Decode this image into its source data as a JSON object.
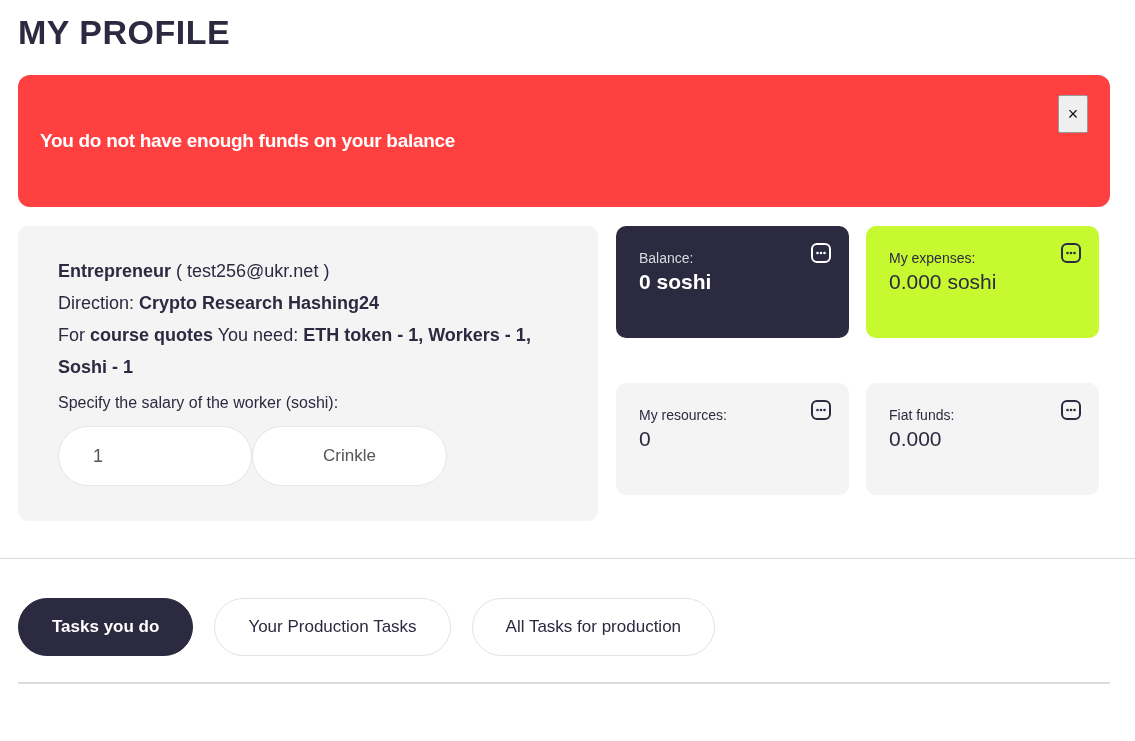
{
  "title": "MY PROFILE",
  "alert": {
    "message": "You do not have enough funds on your balance",
    "close_label": "×"
  },
  "profile": {
    "lines": [
      "**Entrepreneur** ( test256@ukr.net )",
      "Direction: **Crypto Research Hashing24**",
      "For **course quotes** You need: **ETH token - 1, Workers - 1, Soshi - 1**"
    ],
    "salary_label": "Specify the salary of the worker (soshi):",
    "salary_field": {
      "value": "1"
    },
    "submit_button": "Crinkle"
  },
  "stats": [
    {
      "kind": "dark",
      "label": "Balance:",
      "value": "0 soshi"
    },
    {
      "kind": "accent",
      "label": "My expenses:",
      "value": "0.000 soshi"
    },
    {
      "kind": "plain",
      "label": "My resources:",
      "value": "0"
    },
    {
      "kind": "plain",
      "label": "Fiat funds:",
      "value": "0.000"
    }
  ],
  "tabs": [
    {
      "label": "Tasks you do",
      "selected": true
    },
    {
      "label": "Your Production Tasks",
      "selected": false
    },
    {
      "label": "All Tasks for production",
      "selected": false
    }
  ]
}
